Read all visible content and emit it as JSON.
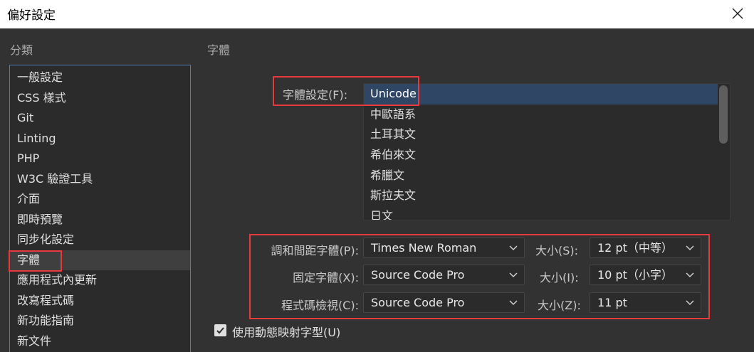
{
  "window": {
    "title": "偏好設定"
  },
  "sidebar": {
    "heading": "分類",
    "items": [
      {
        "label": "一般設定"
      },
      {
        "label": "CSS 樣式"
      },
      {
        "label": "Git"
      },
      {
        "label": "Linting"
      },
      {
        "label": "PHP"
      },
      {
        "label": "W3C 驗證工具"
      },
      {
        "label": "介面"
      },
      {
        "label": "即時預覽"
      },
      {
        "label": "同步化設定"
      },
      {
        "label": "字體"
      },
      {
        "label": "應用程式內更新"
      },
      {
        "label": "改寫程式碼"
      },
      {
        "label": "新功能指南"
      },
      {
        "label": "新文件"
      }
    ],
    "selected_index": 9
  },
  "main": {
    "heading": "字體",
    "encoding_label": "字體設定(F):",
    "encodings": [
      "Unicode",
      "中歐語系",
      "土耳其文",
      "希伯來文",
      "希臘文",
      "斯拉夫文",
      "日文"
    ],
    "selected_encoding": "Unicode",
    "fonts": [
      {
        "label": "調和間距字體(P):",
        "font": "Times New Roman",
        "size_label": "大小(S):",
        "size": "12 pt（中等）"
      },
      {
        "label": "固定字體(X):",
        "font": "Source Code Pro",
        "size_label": "大小(I):",
        "size": "10 pt（小字）"
      },
      {
        "label": "程式碼檢視(C):",
        "font": "Source Code Pro",
        "size_label": "大小(Z):",
        "size": "11 pt"
      }
    ],
    "checkbox": {
      "label": "使用動態映射字型(U)",
      "checked": true
    }
  },
  "colors": {
    "highlight_box": "#e8393e",
    "selection": "#2f4764",
    "sidebar_border": "#4a7fb5"
  }
}
